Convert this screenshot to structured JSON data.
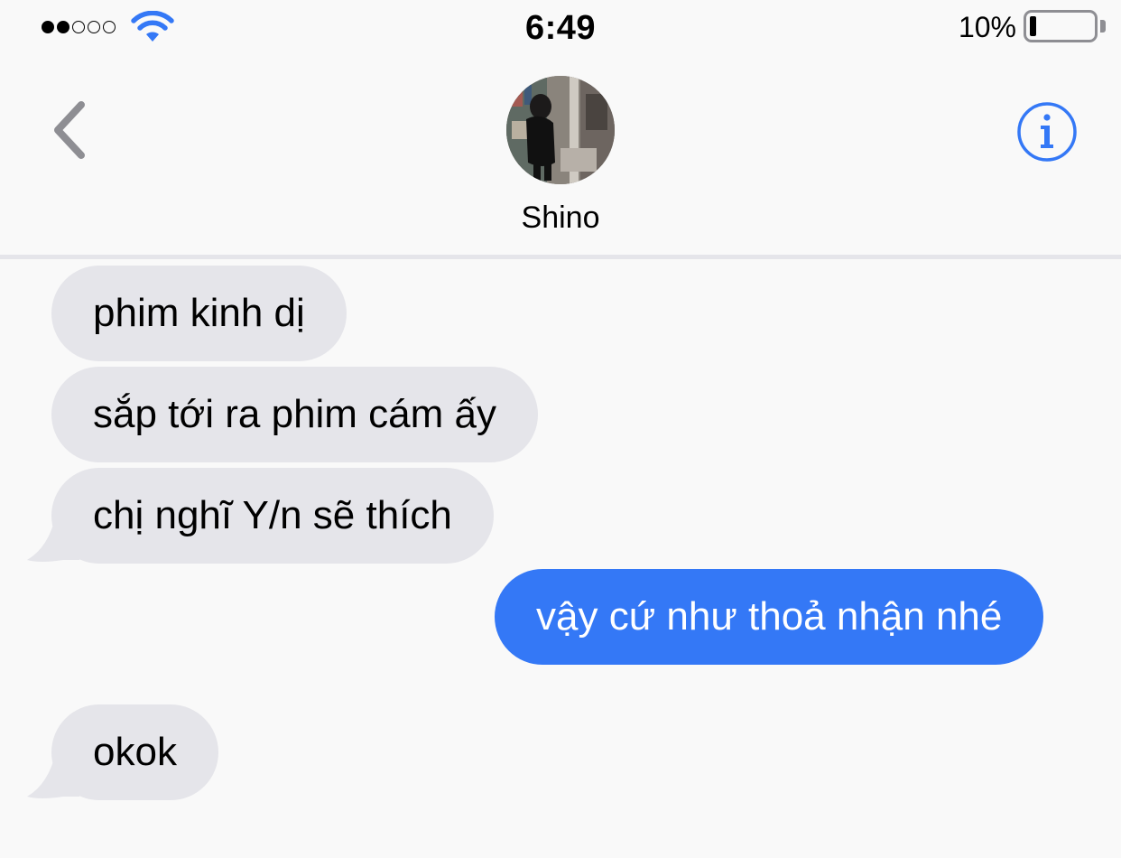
{
  "status_bar": {
    "signal_bars_filled": 2,
    "signal_bars_total": 5,
    "wifi_icon": "wifi-icon",
    "time": "6:49",
    "battery_percent": "10%",
    "battery_level": 0.1
  },
  "header": {
    "back_icon": "chevron-left-icon",
    "contact_name": "Shino",
    "info_icon": "info-icon"
  },
  "messages": [
    {
      "direction": "incoming",
      "text": "phim kinh dị"
    },
    {
      "direction": "incoming",
      "text": "sắp tới ra phim cám ấy"
    },
    {
      "direction": "incoming",
      "text": "chị nghĩ Y/n sẽ thích"
    },
    {
      "direction": "outgoing",
      "text": "vậy cứ như thoả nhận nhé"
    },
    {
      "direction": "incoming",
      "text": "okok"
    }
  ],
  "colors": {
    "background": "#f9f9f9",
    "incoming_bubble": "#e5e5ea",
    "outgoing_bubble": "#3478f6",
    "accent": "#3478f6",
    "back_chevron": "#8e8e93"
  }
}
